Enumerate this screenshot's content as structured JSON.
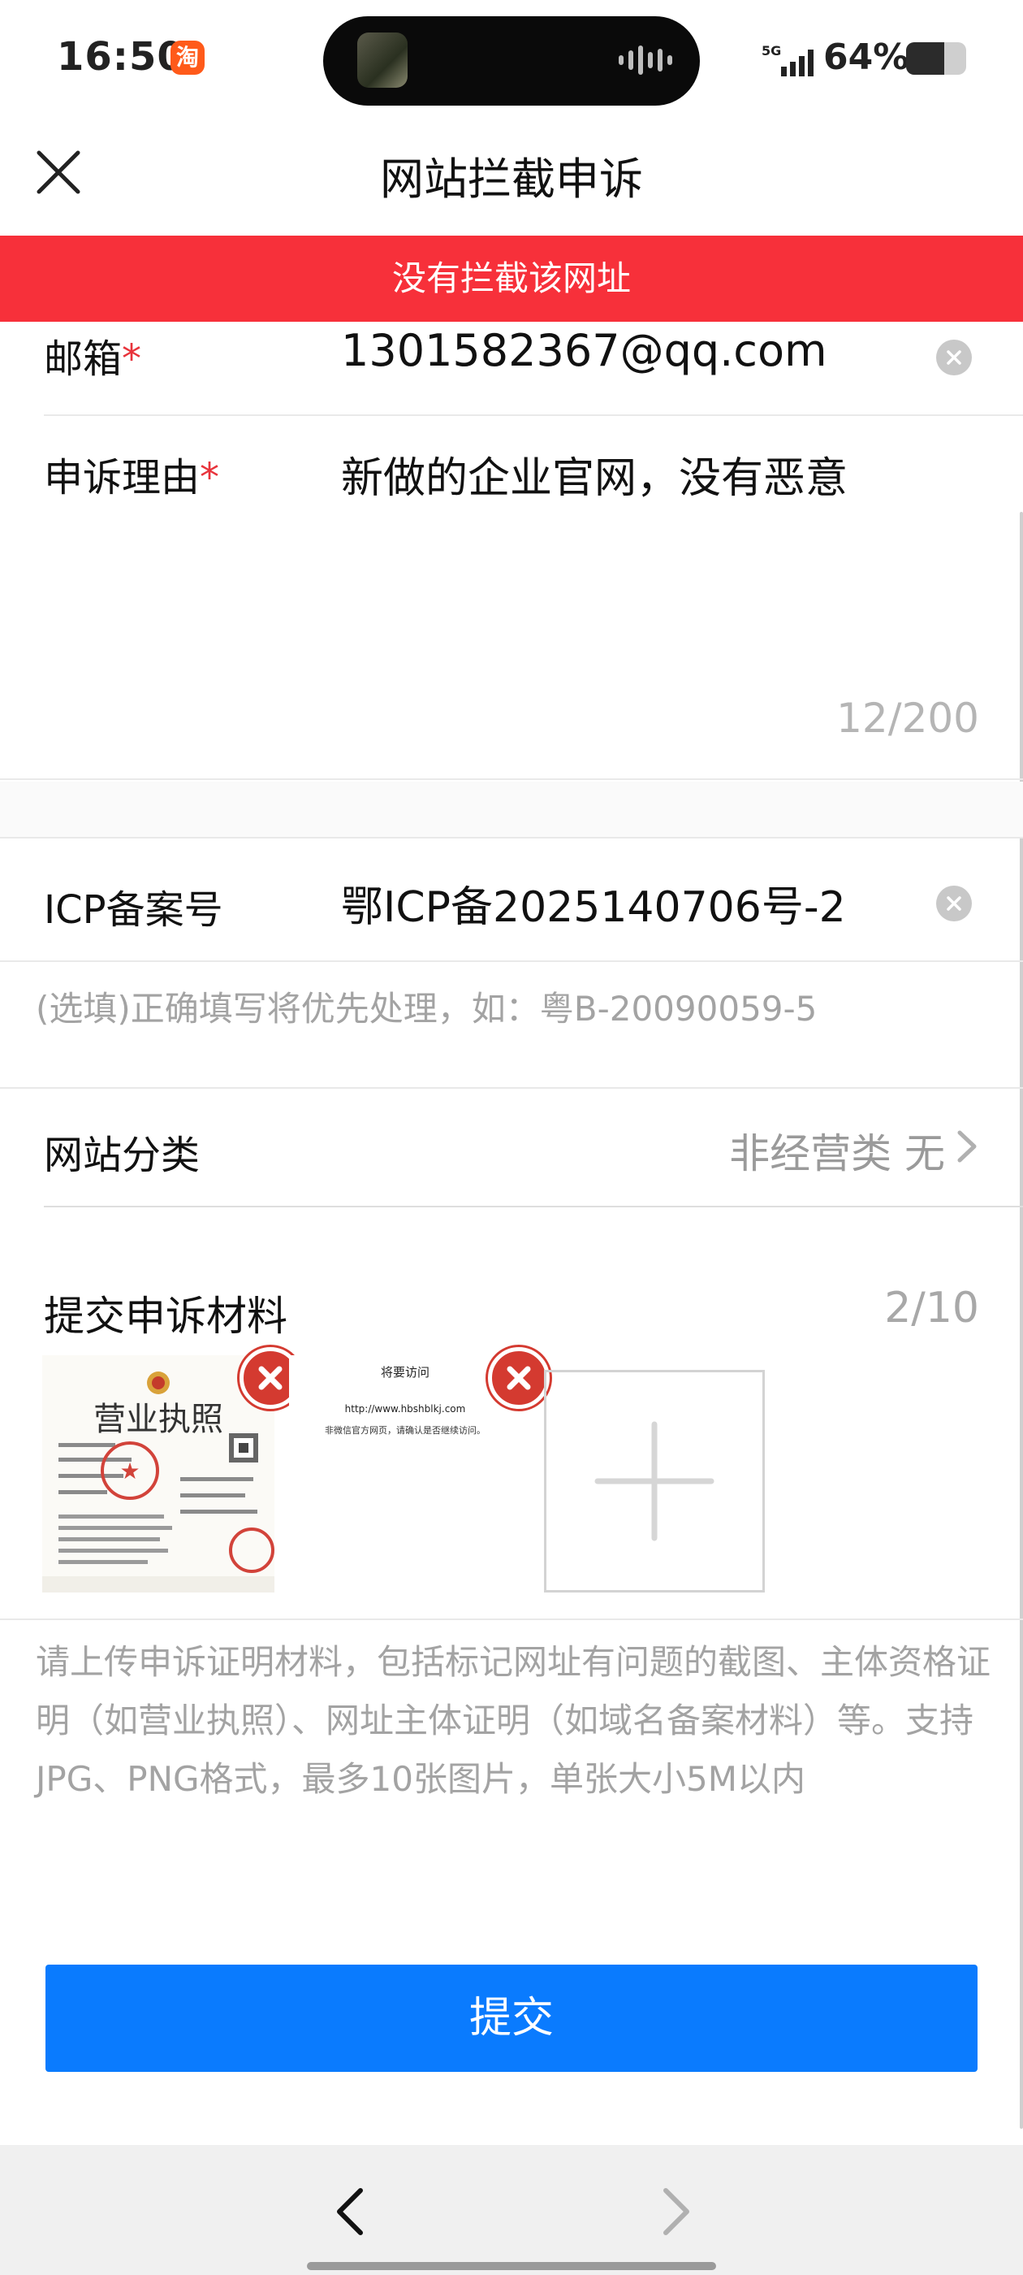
{
  "status_bar": {
    "time": "16:50",
    "app_badge": "淘",
    "network": "5G",
    "battery_percent": "64%",
    "battery_level": 0.64
  },
  "header": {
    "title": "网站拦截申诉"
  },
  "banner": {
    "text": "没有拦截该网址",
    "color": "#f7303a"
  },
  "form": {
    "email": {
      "label": "邮箱",
      "required_mark": "*",
      "value": "1301582367@qq.com"
    },
    "reason": {
      "label": "申诉理由",
      "required_mark": "*",
      "value": "新做的企业官网，没有恶意",
      "counter": "12/200"
    },
    "icp": {
      "label": "ICP备案号",
      "value": "鄂ICP备2025140706号-2",
      "hint": "(选填)正确填写将优先处理，如：粤B-20090059-5"
    },
    "category": {
      "label": "网站分类",
      "value": "非经营类 无"
    },
    "materials": {
      "label": "提交申诉材料",
      "count": "2/10",
      "attachments": [
        {
          "kind": "business-license",
          "heading": "营业执照"
        },
        {
          "kind": "redirect-warning",
          "heading": "将要访问",
          "url": "http://www.hbshblkj.com",
          "note": "非微信官方网页，请确认是否继续访问。"
        }
      ],
      "description": "请上传申诉证明材料，包括标记网址有问题的截图、主体资格证明（如营业执照）、网址主体证明（如域名备案材料）等。支持JPG、PNG格式，最多10张图片，单张大小5M以内"
    }
  },
  "submit": {
    "label": "提交",
    "color": "#0a7bfe"
  }
}
